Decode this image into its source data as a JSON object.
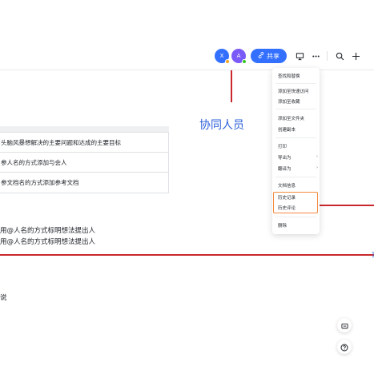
{
  "header": {
    "avatars": [
      {
        "initial": "X",
        "color": "#3370ff",
        "dot": "#f5a623"
      },
      {
        "initial": "A",
        "color": "#7a5af8",
        "dot": "#34c724"
      }
    ],
    "share_label": "共享",
    "icons": [
      "link-icon",
      "presentation-icon",
      "more-icon",
      "search-icon",
      "plus-icon"
    ]
  },
  "annotation": {
    "label": "协同人员",
    "color": "#c8282d"
  },
  "table_rows": [
    "头脑风暴想解决的主要问题和达成的主要目标",
    "参人名的方式添加与会人",
    "参文档名的方式添加参考文档"
  ],
  "body_lines": [
    "用@人名的方式标明想法提出人",
    "用@人名的方式标明想法提出人"
  ],
  "side_text": "说",
  "menu": {
    "items": [
      {
        "label": "查找和替换"
      },
      {
        "label": "添加至快速访问"
      },
      {
        "label": "添加至收藏"
      },
      {
        "label": "添加至文件夹"
      },
      {
        "label": "创建副本"
      },
      {
        "label": "打印"
      },
      {
        "label": "导出为",
        "submenu": true
      },
      {
        "label": "翻译为",
        "submenu": true
      },
      {
        "label": "文档信息"
      },
      {
        "label": "历史记录"
      },
      {
        "label": "历史评论"
      },
      {
        "label": "删除"
      }
    ],
    "highlight_color": "#f58a3c"
  },
  "floating": [
    "comment-icon",
    "help-icon"
  ]
}
